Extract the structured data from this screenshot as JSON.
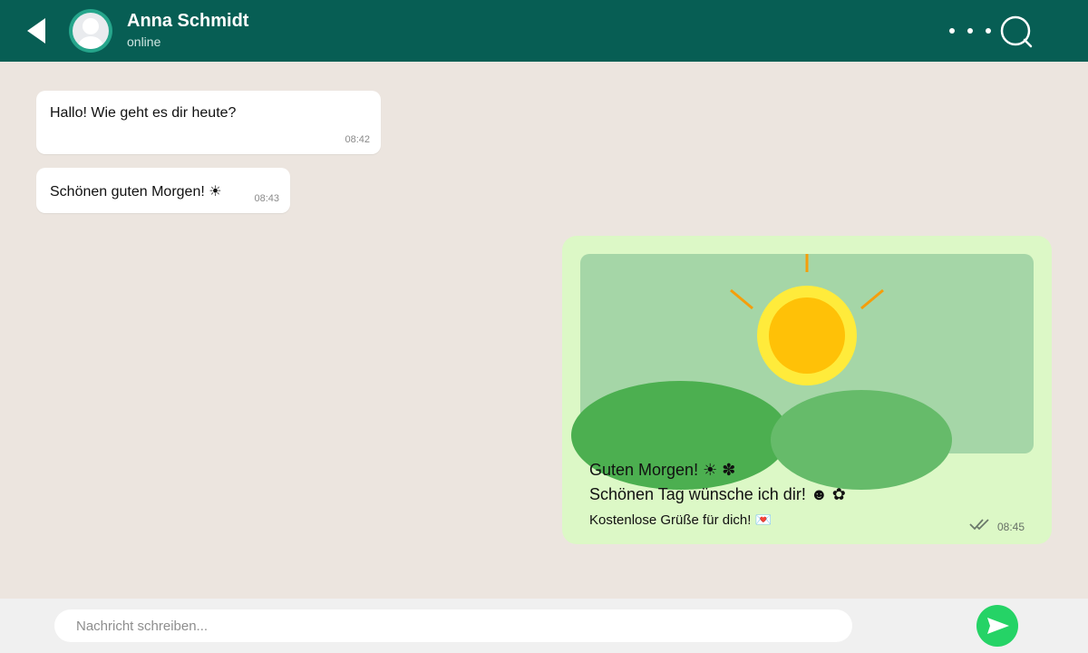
{
  "header": {
    "contact_name": "Anna Schmidt",
    "status": "online",
    "icons": {
      "back": "back-arrow-icon",
      "menu": "more-options-icon",
      "search": "search-icon",
      "avatar": "default-avatar-icon"
    }
  },
  "messages": [
    {
      "direction": "incoming",
      "text": "Hallo! Wie geht es dir heute?",
      "time": "08:42"
    },
    {
      "direction": "incoming",
      "text": "Schönen guten Morgen! ☀",
      "time": "08:43"
    },
    {
      "direction": "outgoing",
      "lines": [
        "Guten Morgen! ☀ ✽",
        "Schönen Tag wünsche ich dir! ☻ ✿",
        "Kostenlose Grüße für dich! 💌"
      ],
      "time": "08:45",
      "status_icon": "double-check-icon"
    }
  ],
  "composer": {
    "placeholder": "Nachricht schreiben...",
    "send_icon": "send-icon"
  },
  "colors": {
    "header": "#075e54",
    "chat_background": "#ece5df",
    "incoming_bubble": "#ffffff",
    "outgoing_bubble": "#dcf8c6",
    "send_button": "#25d366",
    "sun": "#ffc107",
    "hills": "#4caf50"
  }
}
